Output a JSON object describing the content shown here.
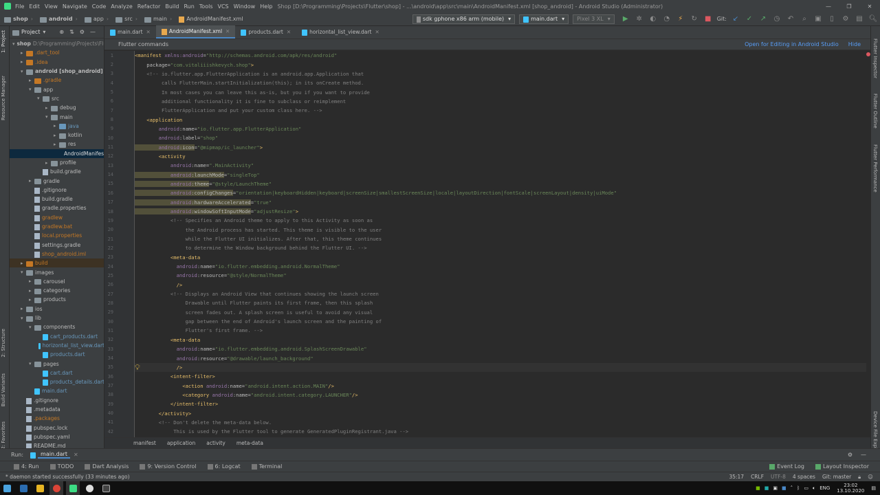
{
  "titlebar": {
    "menu": [
      "File",
      "Edit",
      "View",
      "Navigate",
      "Code",
      "Analyze",
      "Refactor",
      "Build",
      "Run",
      "Tools",
      "VCS",
      "Window",
      "Help"
    ],
    "title": "Shop [D:\\Programming\\Projects\\Flutter\\shop] - ...\\android\\app\\src\\main\\AndroidManifest.xml [shop_android] - Android Studio (Administrator)"
  },
  "navbar": {
    "breadcrumbs": [
      "shop",
      "android",
      "app",
      "src",
      "main",
      "AndroidManifest.xml"
    ],
    "device": "sdk gphone x86 arm (mobile)",
    "run_config": "main.dart",
    "avd": "Pixel 3 XL",
    "git_label": "Git:"
  },
  "project": {
    "title": "Project",
    "tree": [
      {
        "label": "shop",
        "extra": "D:\\Programming\\Projects\\Flutter",
        "depth": 0,
        "arrow": "▾",
        "icon": "folder",
        "bold": true
      },
      {
        "label": ".dart_tool",
        "depth": 1,
        "arrow": "▸",
        "icon": "folder orange",
        "color": "#c57825"
      },
      {
        "label": ".idea",
        "depth": 1,
        "arrow": "▸",
        "icon": "folder orange",
        "color": "#c57825"
      },
      {
        "label": "android [shop_android]",
        "depth": 1,
        "arrow": "▾",
        "icon": "folder",
        "bold": true
      },
      {
        "label": ".gradle",
        "depth": 2,
        "arrow": "▸",
        "icon": "folder orange",
        "color": "#c57825"
      },
      {
        "label": "app",
        "depth": 2,
        "arrow": "▾",
        "icon": "folder"
      },
      {
        "label": "src",
        "depth": 3,
        "arrow": "▾",
        "icon": "folder"
      },
      {
        "label": "debug",
        "depth": 4,
        "arrow": "▸",
        "icon": "folder"
      },
      {
        "label": "main",
        "depth": 4,
        "arrow": "▾",
        "icon": "folder"
      },
      {
        "label": "java",
        "depth": 5,
        "arrow": "▸",
        "icon": "folder blue",
        "color": "#6897bb"
      },
      {
        "label": "kotlin",
        "depth": 5,
        "arrow": "▸",
        "icon": "folder"
      },
      {
        "label": "res",
        "depth": 5,
        "arrow": "▸",
        "icon": "folder"
      },
      {
        "label": "AndroidManifest.xml",
        "depth": 6,
        "arrow": "",
        "icon": "file xml",
        "sel": true
      },
      {
        "label": "profile",
        "depth": 4,
        "arrow": "▸",
        "icon": "folder"
      },
      {
        "label": "build.gradle",
        "depth": 3,
        "arrow": "",
        "icon": "file"
      },
      {
        "label": "gradle",
        "depth": 2,
        "arrow": "▸",
        "icon": "folder"
      },
      {
        "label": ".gitignore",
        "depth": 2,
        "arrow": "",
        "icon": "file"
      },
      {
        "label": "build.gradle",
        "depth": 2,
        "arrow": "",
        "icon": "file"
      },
      {
        "label": "gradle.properties",
        "depth": 2,
        "arrow": "",
        "icon": "file"
      },
      {
        "label": "gradlew",
        "depth": 2,
        "arrow": "",
        "icon": "file",
        "color": "#c57825"
      },
      {
        "label": "gradlew.bat",
        "depth": 2,
        "arrow": "",
        "icon": "file",
        "color": "#c57825"
      },
      {
        "label": "local.properties",
        "depth": 2,
        "arrow": "",
        "icon": "file",
        "color": "#c57825"
      },
      {
        "label": "settings.gradle",
        "depth": 2,
        "arrow": "",
        "icon": "file"
      },
      {
        "label": "shop_android.iml",
        "depth": 2,
        "arrow": "",
        "icon": "file",
        "color": "#c57825"
      },
      {
        "label": "build",
        "depth": 1,
        "arrow": "▸",
        "icon": "folder orange",
        "color": "#c57825",
        "hl": true
      },
      {
        "label": "images",
        "depth": 1,
        "arrow": "▾",
        "icon": "folder"
      },
      {
        "label": "carousel",
        "depth": 2,
        "arrow": "▸",
        "icon": "folder"
      },
      {
        "label": "categories",
        "depth": 2,
        "arrow": "▸",
        "icon": "folder"
      },
      {
        "label": "products",
        "depth": 2,
        "arrow": "▸",
        "icon": "folder"
      },
      {
        "label": "ios",
        "depth": 1,
        "arrow": "▸",
        "icon": "folder"
      },
      {
        "label": "lib",
        "depth": 1,
        "arrow": "▾",
        "icon": "folder"
      },
      {
        "label": "components",
        "depth": 2,
        "arrow": "▾",
        "icon": "folder"
      },
      {
        "label": "cart_products.dart",
        "depth": 3,
        "arrow": "",
        "icon": "file dart",
        "color": "#6897bb"
      },
      {
        "label": "horizontal_list_view.dart",
        "depth": 3,
        "arrow": "",
        "icon": "file dart",
        "color": "#6897bb"
      },
      {
        "label": "products.dart",
        "depth": 3,
        "arrow": "",
        "icon": "file dart",
        "color": "#6897bb"
      },
      {
        "label": "pages",
        "depth": 2,
        "arrow": "▾",
        "icon": "folder"
      },
      {
        "label": "cart.dart",
        "depth": 3,
        "arrow": "",
        "icon": "file dart",
        "color": "#6897bb"
      },
      {
        "label": "products_details.dart",
        "depth": 3,
        "arrow": "",
        "icon": "file dart",
        "color": "#6897bb"
      },
      {
        "label": "main.dart",
        "depth": 2,
        "arrow": "",
        "icon": "file dart",
        "color": "#6897bb"
      },
      {
        "label": ".gitignore",
        "depth": 1,
        "arrow": "",
        "icon": "file"
      },
      {
        "label": ".metadata",
        "depth": 1,
        "arrow": "",
        "icon": "file"
      },
      {
        "label": ".packages",
        "depth": 1,
        "arrow": "",
        "icon": "file",
        "color": "#c57825"
      },
      {
        "label": "pubspec.lock",
        "depth": 1,
        "arrow": "",
        "icon": "file"
      },
      {
        "label": "pubspec.yaml",
        "depth": 1,
        "arrow": "",
        "icon": "file"
      },
      {
        "label": "README.md",
        "depth": 1,
        "arrow": "",
        "icon": "file"
      }
    ]
  },
  "tabs": [
    {
      "label": "main.dart",
      "icon": "dart"
    },
    {
      "label": "AndroidManifest.xml",
      "icon": "xml",
      "active": true
    },
    {
      "label": "products.dart",
      "icon": "dart"
    },
    {
      "label": "horizontal_list_view.dart",
      "icon": "dart"
    }
  ],
  "notice": {
    "text": "Flutter commands",
    "open_link": "Open for Editing in Android Studio",
    "hide": "Hide"
  },
  "code_lines": [
    [
      [
        "t-tag",
        "<manifest "
      ],
      [
        "t-ns",
        "xmlns:android"
      ],
      [
        "t-attr",
        "="
      ],
      [
        "t-str",
        "\"http://schemas.android.com/apk/res/android\""
      ]
    ],
    [
      [
        "t-attr",
        "    package"
      ],
      [
        "t-attr",
        "="
      ],
      [
        "t-str",
        "\"com.vitaliiishkevych.shop\""
      ],
      [
        "t-tag",
        ">"
      ]
    ],
    [
      [
        "t-cm",
        "    <!-- io.flutter.app.FlutterApplication is an android.app.Application that"
      ]
    ],
    [
      [
        "t-cm",
        "         calls FlutterMain.startInitialization(this); in its onCreate method."
      ]
    ],
    [
      [
        "t-cm",
        "         In most cases you can leave this as-is, but you if you want to provide"
      ]
    ],
    [
      [
        "t-cm",
        "         additional functionality it is fine to subclass or reimplement"
      ]
    ],
    [
      [
        "t-cm",
        "         FlutterApplication and put your custom class here. -->"
      ]
    ],
    [
      [
        "t-tag",
        "    <application"
      ]
    ],
    [
      [
        "t-ns",
        "        android"
      ],
      [
        "t-attr",
        ":name="
      ],
      [
        "t-str",
        "\"io.flutter.app.FlutterApplication\""
      ]
    ],
    [
      [
        "t-ns",
        "        android"
      ],
      [
        "t-attr",
        ":label="
      ],
      [
        "t-str",
        "\"shop\""
      ]
    ],
    [
      [
        "t-ns t-warn",
        "        android"
      ],
      [
        "t-attr t-warn",
        ":icon"
      ],
      [
        "t-attr",
        "="
      ],
      [
        "t-str",
        "\"@mipmap/ic_launcher\""
      ],
      [
        "t-tag",
        ">"
      ]
    ],
    [
      [
        "t-tag",
        "        <activity"
      ]
    ],
    [
      [
        "t-ns",
        "            android"
      ],
      [
        "t-attr",
        ":name="
      ],
      [
        "t-str",
        "\".MainActivity\""
      ]
    ],
    [
      [
        "t-ns t-warn",
        "            android"
      ],
      [
        "t-attr t-warn",
        ":launchMode"
      ],
      [
        "t-attr",
        "="
      ],
      [
        "t-str",
        "\"singleTop\""
      ]
    ],
    [
      [
        "t-ns t-warn",
        "            android"
      ],
      [
        "t-attr t-warn",
        ":theme"
      ],
      [
        "t-attr",
        "="
      ],
      [
        "t-str",
        "\"@style/LaunchTheme\""
      ]
    ],
    [
      [
        "t-ns t-warn",
        "            android"
      ],
      [
        "t-attr t-warn",
        ":configChanges"
      ],
      [
        "t-attr",
        "="
      ],
      [
        "t-str",
        "\"orientation|keyboardHidden|keyboard|screenSize|smallestScreenSize|locale|layoutDirection|fontScale|screenLayout|density|uiMode\""
      ]
    ],
    [
      [
        "t-ns t-warn",
        "            android"
      ],
      [
        "t-attr t-warn",
        ":hardwareAccelerated"
      ],
      [
        "t-attr",
        "="
      ],
      [
        "t-str",
        "\"true\""
      ]
    ],
    [
      [
        "t-ns t-warn",
        "            android"
      ],
      [
        "t-attr t-warn",
        ":windowSoftInputMode"
      ],
      [
        "t-attr",
        "="
      ],
      [
        "t-str",
        "\"adjustResize\""
      ],
      [
        "t-tag",
        ">"
      ]
    ],
    [
      [
        "t-cm",
        "            <!-- Specifies an Android theme to apply to this Activity as soon as"
      ]
    ],
    [
      [
        "t-cm",
        "                 the Android process has started. This theme is visible to the user"
      ]
    ],
    [
      [
        "t-cm",
        "                 while the Flutter UI initializes. After that, this theme continues"
      ]
    ],
    [
      [
        "t-cm",
        "                 to determine the Window background behind the Flutter UI. -->"
      ]
    ],
    [
      [
        "t-tag",
        "            <meta-data"
      ]
    ],
    [
      [
        "t-ns",
        "              android"
      ],
      [
        "t-attr",
        ":name="
      ],
      [
        "t-str",
        "\"io.flutter.embedding.android.NormalTheme\""
      ]
    ],
    [
      [
        "t-ns",
        "              android"
      ],
      [
        "t-attr",
        ":resource="
      ],
      [
        "t-str",
        "\"@style/NormalTheme\""
      ]
    ],
    [
      [
        "t-tag",
        "              />"
      ]
    ],
    [
      [
        "t-cm",
        "            <!-- Displays an Android View that continues showing the launch screen"
      ]
    ],
    [
      [
        "t-cm",
        "                 Drawable until Flutter paints its first frame, then this splash"
      ]
    ],
    [
      [
        "t-cm",
        "                 screen fades out. A splash screen is useful to avoid any visual"
      ]
    ],
    [
      [
        "t-cm",
        "                 gap between the end of Android's launch screen and the painting of"
      ]
    ],
    [
      [
        "t-cm",
        "                 Flutter's first frame. -->"
      ]
    ],
    [
      [
        "t-tag",
        "            <meta-data"
      ]
    ],
    [
      [
        "t-ns",
        "              android"
      ],
      [
        "t-attr",
        ":name="
      ],
      [
        "t-str",
        "\"io.flutter.embedding.android.SplashScreenDrawable\""
      ]
    ],
    [
      [
        "t-ns",
        "              android"
      ],
      [
        "t-attr",
        ":resource="
      ],
      [
        "t-str",
        "\"@drawable/launch_background\""
      ]
    ],
    [
      [
        "t-tag",
        "              />"
      ]
    ],
    [
      [
        "t-tag",
        "            <intent-filter>"
      ]
    ],
    [
      [
        "t-tag",
        "                <action "
      ],
      [
        "t-ns",
        "android"
      ],
      [
        "t-attr",
        ":name="
      ],
      [
        "t-str",
        "\"android.intent.action.MAIN\""
      ],
      [
        "t-tag",
        "/>"
      ]
    ],
    [
      [
        "t-tag",
        "                <category "
      ],
      [
        "t-ns",
        "android"
      ],
      [
        "t-attr",
        ":name="
      ],
      [
        "t-str",
        "\"android.intent.category.LAUNCHER\""
      ],
      [
        "t-tag",
        "/>"
      ]
    ],
    [
      [
        "t-tag",
        "            </intent-filter>"
      ]
    ],
    [
      [
        "t-tag",
        "        </activity>"
      ]
    ],
    [
      [
        "t-cm",
        "        <!-- Don't delete the meta-data below."
      ]
    ],
    [
      [
        "t-cm",
        "             This is used by the Flutter tool to generate GeneratedPluginRegistrant.java -->"
      ]
    ]
  ],
  "breadcrumb_bar": [
    "manifest",
    "application",
    "activity",
    "meta-data"
  ],
  "runbar": {
    "label": "Run:",
    "config": "main.dart"
  },
  "toolwindows": [
    "4: Run",
    "TODO",
    "Dart Analysis",
    "9: Version Control",
    "6: Logcat",
    "Terminal"
  ],
  "toolwindows_right": [
    "Event Log",
    "Layout Inspector"
  ],
  "status": {
    "message": "* daemon started successfully (33 minutes ago)",
    "position": "35:17",
    "line_sep": "CRLF",
    "encoding": "UTF-8",
    "indent": "4 spaces",
    "git": "Git: master"
  },
  "left_strip": [
    "1: Project",
    "Resource Manager",
    "2: Structure",
    "Build Variants",
    "2: Favorites"
  ],
  "right_strip": [
    "Flutter Inspector",
    "Flutter Outline",
    "Flutter Performance",
    "Device File Explorer"
  ],
  "taskbar": {
    "lang": "ENG",
    "time": "23:02",
    "date": "13.10.2020"
  }
}
